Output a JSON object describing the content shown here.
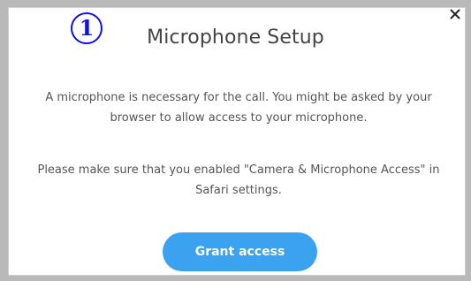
{
  "dialog": {
    "step_badge": "1",
    "title": "Microphone Setup",
    "paragraph_1": "A microphone is necessary for the call. You might be asked by your browser to allow access to your microphone.",
    "paragraph_2": "Please make sure that you enabled \"Camera & Microphone Access\" in Safari settings.",
    "grant_button_label": "Grant access",
    "close_icon": "close-icon"
  },
  "colors": {
    "button": "#3aa2ee",
    "badge": "#1010e8",
    "frame": "#b9b9b9"
  }
}
